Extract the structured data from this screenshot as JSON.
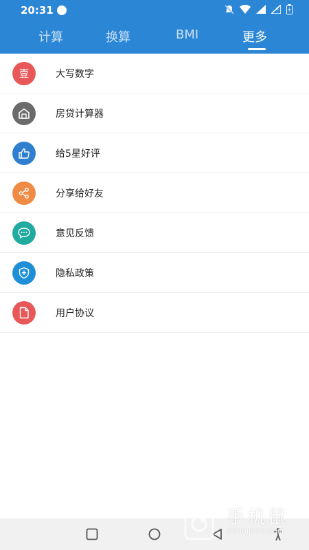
{
  "status": {
    "time": "20:31"
  },
  "tabs": [
    {
      "label": "计算"
    },
    {
      "label": "换算"
    },
    {
      "label": "BMI"
    },
    {
      "label": "更多"
    }
  ],
  "active_tab": "更多",
  "items": [
    {
      "label": "大写数字",
      "icon": "yi-character-icon",
      "icon_text": "壹",
      "color": "#e95858"
    },
    {
      "label": "房贷计算器",
      "icon": "house-icon",
      "color": "#6b6b6b"
    },
    {
      "label": "给5星好评",
      "icon": "thumbs-up-icon",
      "color": "#2f7fce"
    },
    {
      "label": "分享给好友",
      "icon": "share-icon",
      "color": "#ef8b45"
    },
    {
      "label": "意见反馈",
      "icon": "chat-bubble-icon",
      "color": "#20aaa0"
    },
    {
      "label": "隐私政策",
      "icon": "shield-plus-icon",
      "color": "#1e8fd6"
    },
    {
      "label": "用户协议",
      "icon": "document-icon",
      "color": "#e95858"
    }
  ],
  "colors": {
    "primary": "#2b86d5"
  },
  "watermark": {
    "title": "手机鼠",
    "subtitle": "SHOUJISHU.COM"
  }
}
